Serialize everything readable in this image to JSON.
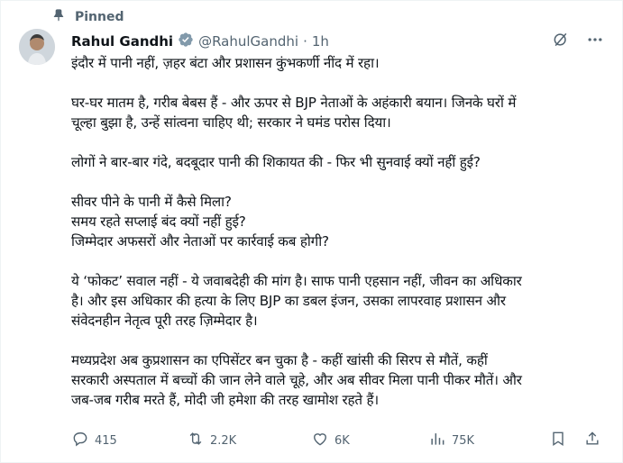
{
  "pinned_label": "Pinned",
  "author": {
    "name": "Rahul Gandhi",
    "handle": "@RahulGandhi",
    "separator": "·",
    "time": "1h"
  },
  "tweet": {
    "paragraphs": [
      [
        "इंदौर में पानी नहीं, ज़हर बंटा और प्रशासन कुंभकर्णी नींद में रहा।"
      ],
      [
        "घर-घर मातम है, गरीब बेबस हैं - और ऊपर से BJP नेताओं के अहंकारी बयान। जिनके घरों में",
        "चूल्हा बुझा है, उन्हें सांत्वना चाहिए थी; सरकार ने घमंड परोस दिया।"
      ],
      [
        "लोगों ने बार-बार गंदे, बदबूदार पानी की शिकायत की - फिर भी सुनवाई क्यों नहीं हुई?"
      ],
      [
        "सीवर पीने के पानी में कैसे मिला?",
        "समय रहते सप्लाई बंद क्यों नहीं हुई?",
        "जिम्मेदार अफसरों और नेताओं पर कार्रवाई कब होगी?"
      ],
      [
        "ये ‘फोकट’ सवाल नहीं - ये जवाबदेही की मांग है। साफ पानी एहसान नहीं, जीवन का अधिकार",
        "है। और इस अधिकार की हत्या के लिए BJP का डबल इंजन, उसका लापरवाह प्रशासन और",
        "संवेदनहीन नेतृत्व पूरी तरह ज़िम्मेदार है।"
      ],
      [
        "मध्यप्रदेश अब कुप्रशासन का एपिसेंटर बन चुका है - कहीं खांसी की सिरप से मौतें, कहीं",
        "सरकारी अस्पताल में बच्चों की जान लेने वाले चूहे, और अब सीवर मिला पानी पीकर मौतें। और",
        "जब-जब गरीब मरते हैं, मोदी जी हमेशा की तरह खामोश रहते हैं।"
      ]
    ]
  },
  "metrics": {
    "replies": "415",
    "reposts": "2.2K",
    "likes": "6K",
    "views": "75K"
  },
  "colors": {
    "text": "#0f1419",
    "secondary": "#536471",
    "verified": "#1d9bf0",
    "border": "#eff3f4"
  },
  "icons": [
    "pin-icon",
    "verified-badge-icon",
    "grok-icon",
    "more-icon",
    "reply-icon",
    "repost-icon",
    "like-icon",
    "views-icon",
    "bookmark-icon",
    "share-icon"
  ]
}
